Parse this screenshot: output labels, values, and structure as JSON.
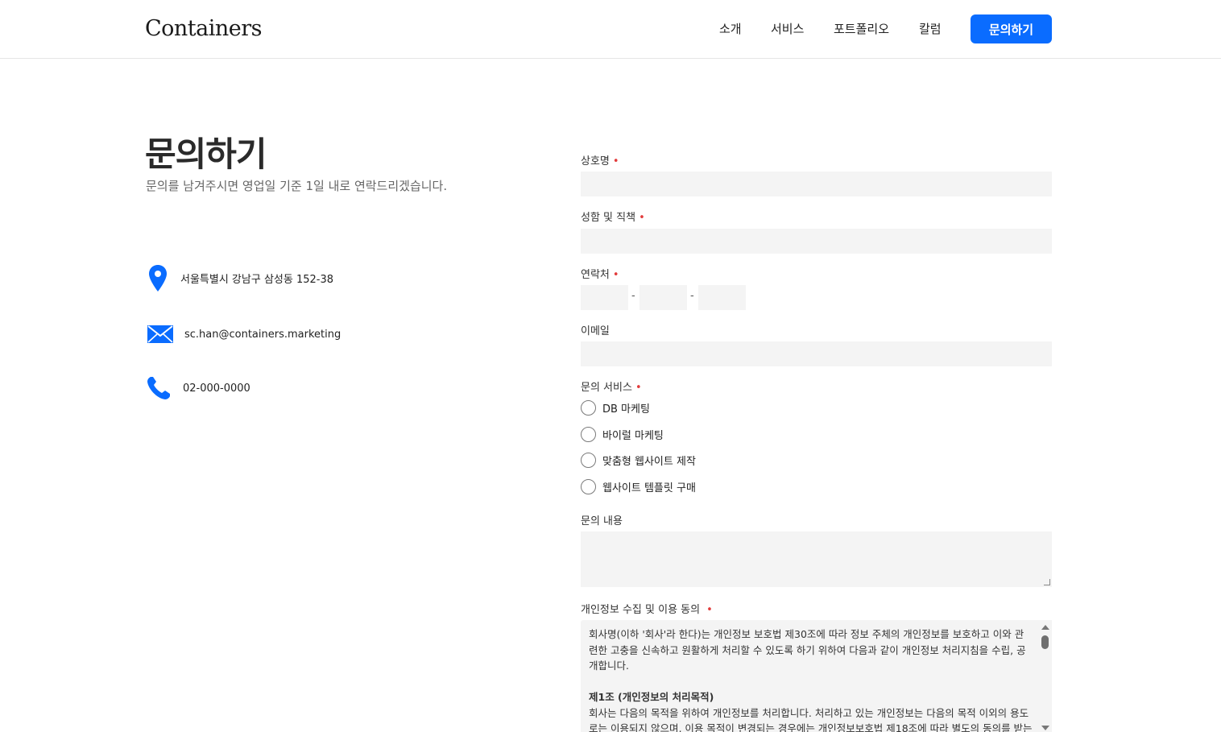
{
  "header": {
    "logo": "Containers",
    "nav": [
      {
        "label": "소개"
      },
      {
        "label": "서비스"
      },
      {
        "label": "포트폴리오"
      },
      {
        "label": "칼럼"
      }
    ],
    "cta_label": "문의하기"
  },
  "intro": {
    "title": "문의하기",
    "subtitle": "문의를 남겨주시면 영업일 기준 1일 내로 연락드리겠습니다."
  },
  "contact_info": {
    "address": "서울특별시 강남구 삼성동 152-38",
    "email": "sc.han@containers.marketing",
    "phone": "02-000-0000"
  },
  "form": {
    "company_label": "상호명",
    "name_title_label": "성함 및 직책",
    "contact_label": "연락처",
    "contact_separator": "-",
    "email_label": "이메일",
    "service_label": "문의 서비스",
    "required_mark": "•",
    "services": [
      {
        "label": "DB 마케팅"
      },
      {
        "label": "바이럴 마케팅"
      },
      {
        "label": "맞춤형 웹사이트 제작"
      },
      {
        "label": "웹사이트 템플릿 구매"
      }
    ],
    "message_label": "문의 내용",
    "privacy_label": "개인정보 수집 및 이용 동의",
    "privacy_lines": [
      "회사명(이하 '회사'라 한다)는 개인정보 보호법 제30조에 따라 정보 주체의 개인정보를 보호하고 이와 관",
      "련한 고충을 신속하고 원활하게 처리할 수 있도록 하기 위하여 다음과 같이 개인정보 처리지침을 수립, 공",
      "개합니다.",
      "제1조 (개인정보의 처리목적)",
      "회사는 다음의 목적을 위하여 개인정보를 처리합니다. 처리하고 있는 개인정보는 다음의 목적 이외의 용도",
      "로는 이용되지 않으며, 이용 목적이 변경되는 경우에는 개인정보보호법 제18조에 따라 별도의 동의를 받는"
    ]
  }
}
